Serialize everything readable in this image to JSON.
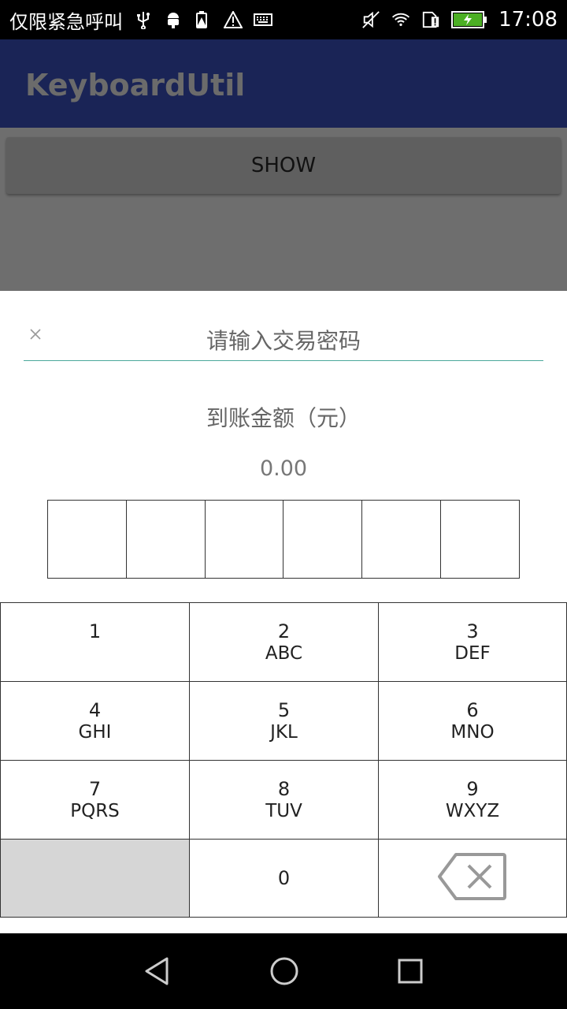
{
  "status_bar": {
    "carrier": "仅限紧急呼叫",
    "time": "17:08",
    "left_icons": [
      "usb-icon",
      "android-debug-icon",
      "battery-warning-icon",
      "warning-icon",
      "keyboard-icon"
    ],
    "right_icons": [
      "mute-icon",
      "wifi-icon",
      "sim-alert-icon",
      "battery-charging-icon"
    ]
  },
  "app_bar": {
    "title": "KeyboardUtil"
  },
  "content": {
    "show_button": "SHOW"
  },
  "dialog": {
    "title": "请输入交易密码",
    "amount_label": "到账金额（元）",
    "amount_value": "0.00",
    "password_length": 6
  },
  "keypad": {
    "keys": [
      {
        "num": "1",
        "letters": ""
      },
      {
        "num": "2",
        "letters": "ABC"
      },
      {
        "num": "3",
        "letters": "DEF"
      },
      {
        "num": "4",
        "letters": "GHI"
      },
      {
        "num": "5",
        "letters": "JKL"
      },
      {
        "num": "6",
        "letters": "MNO"
      },
      {
        "num": "7",
        "letters": "PQRS"
      },
      {
        "num": "8",
        "letters": "TUV"
      },
      {
        "num": "9",
        "letters": "WXYZ"
      },
      {
        "num": "0",
        "letters": ""
      }
    ]
  },
  "colors": {
    "app_bar": "#1a2456",
    "divider": "#4aa89b",
    "blank_key": "#d6d6d6"
  }
}
